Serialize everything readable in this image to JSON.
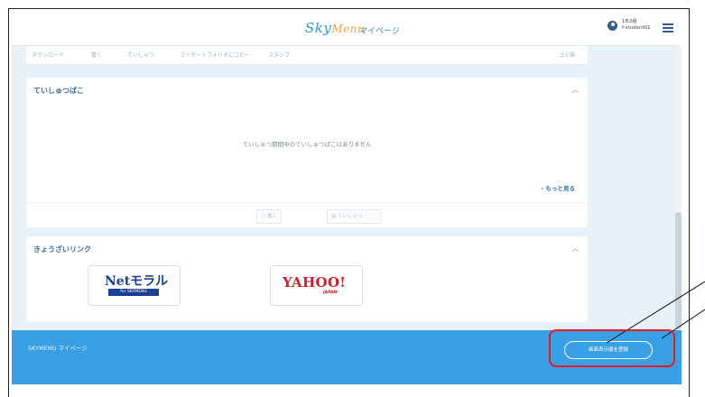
{
  "header": {
    "logo": {
      "sky": "Sky",
      "menu": "Menu"
    },
    "mypage_label": "マイページ",
    "user_class": "1年2組",
    "user_name": "f-student01"
  },
  "toolbar": {
    "items": [
      "ダウンロード",
      "書く",
      "ていしゅつ",
      "マイポートフォリオにコピー",
      "スタンプ",
      "ゴミ箱"
    ]
  },
  "submission_box": {
    "title": "ていしゅつばこ",
    "empty_message": "ていしゅつ期間中のていしゅつばこはありません",
    "more_link": "もっと見る",
    "write_button": "書く",
    "submit_button": "ていしゅつ"
  },
  "links_panel": {
    "title": "きょうざいリンク",
    "netmoral": {
      "main": "Netモラル",
      "sub": "for SKYMENU"
    },
    "yahoo": {
      "main": "YAHOO!",
      "sub": "JAPAN"
    }
  },
  "footer": {
    "title": "SKYMENU マイページ",
    "register_button": "画面表示順を登録"
  },
  "colors": {
    "accent": "#3aa0e6",
    "highlight_red": "#e8191f",
    "title_blue": "#3b6f99"
  }
}
